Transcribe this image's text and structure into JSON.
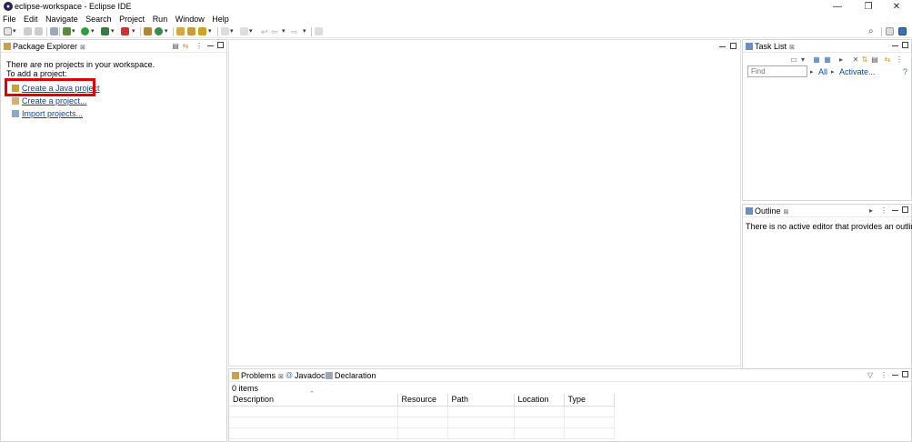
{
  "window": {
    "title": "eclipse-workspace - Eclipse IDE",
    "controls": {
      "minimize": "—",
      "restore": "❐",
      "close": "✕"
    }
  },
  "menu": [
    "File",
    "Edit",
    "Navigate",
    "Search",
    "Project",
    "Run",
    "Window",
    "Help"
  ],
  "package_explorer": {
    "tab_label": "Package Explorer",
    "message": "There are no projects in your workspace.",
    "prompt": "To add a project:",
    "links": [
      "Create a Java project",
      "Create a project...",
      "Import projects..."
    ]
  },
  "task_list": {
    "tab_label": "Task List",
    "find_placeholder": "Find",
    "all_label": "All",
    "activate_label": "Activate...",
    "help": "?"
  },
  "outline": {
    "tab_label": "Outline",
    "message": "There is no active editor that provides an outline."
  },
  "bottom_panel": {
    "tabs": [
      "Problems",
      "Javadoc",
      "Declaration"
    ],
    "count_label": "0 items",
    "columns": [
      "Description",
      "Resource",
      "Path",
      "Location",
      "Type"
    ]
  },
  "colors": {
    "highlight": "#e00000",
    "link": "#0645ad"
  }
}
